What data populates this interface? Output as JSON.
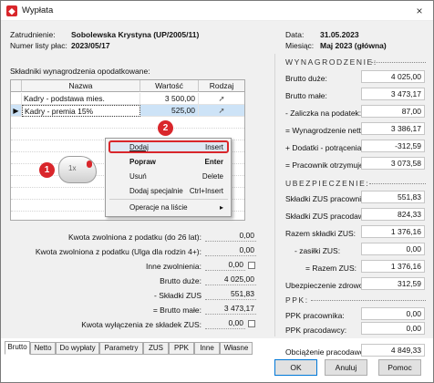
{
  "window": {
    "title": "Wypłata",
    "close_symbol": "×"
  },
  "header": {
    "employee_label": "Zatrudnienie:",
    "employee_value": "Sobolewska Krystyna (UP/2005/11)",
    "list_label": "Numer listy płac:",
    "list_value": "2023/05/17",
    "date_label": "Data:",
    "date_value": "31.05.2023",
    "month_label": "Miesiąc:",
    "month_value": "Maj 2023 (główna)"
  },
  "components": {
    "label": "Składniki wynagrodzenia opodatkowane:",
    "columns": [
      "Nazwa",
      "Wartość",
      "Rodzaj"
    ],
    "rows": [
      {
        "name": "Kadry - podstawa mies.",
        "value": "3 500,00"
      },
      {
        "name": "Kadry - premia 15%",
        "value": "525,00"
      }
    ]
  },
  "context_menu": {
    "items": [
      {
        "label": "Dodaj",
        "shortcut": "Insert"
      },
      {
        "label": "Popraw",
        "shortcut": "Enter"
      },
      {
        "label": "Usuń",
        "shortcut": "Delete"
      },
      {
        "label": "Dodaj specjalnie",
        "shortcut": "Ctrl+Insert"
      },
      {
        "label": "Operacje na liście",
        "shortcut": "▸"
      }
    ]
  },
  "tutorial": {
    "badge1": "1",
    "badge2": "2",
    "mouse_label": "1x"
  },
  "left_summary": [
    {
      "label": "Kwota zwolniona z podatku (do 26 lat):",
      "value": "0,00"
    },
    {
      "label": "Kwota zwolniona z podatku (Ulga dla rodzin 4+):",
      "value": "0,00"
    },
    {
      "label": "Inne zwolnienia:",
      "value": "0,00"
    },
    {
      "label": "Brutto duże:",
      "value": "4 025,00"
    },
    {
      "label": "-  Składki ZUS",
      "value": "551,83"
    },
    {
      "label": "= Brutto małe:",
      "value": "3 473,17"
    },
    {
      "label": "Kwota wyłączenia ze składek ZUS:",
      "value": "0,00"
    }
  ],
  "wynagrodzenie": {
    "title": "WYNAGRODZENIE:",
    "rows": [
      {
        "label": "Brutto duże:",
        "value": "4 025,00"
      },
      {
        "label": "Brutto małe:",
        "value": "3 473,17"
      },
      {
        "label": "- Zaliczka na podatek:",
        "value": "87,00"
      },
      {
        "label": "= Wynagrodzenie netto:",
        "value": "3 386,17"
      },
      {
        "label": "+ Dodatki - potrącenia:",
        "value": "-312,59"
      },
      {
        "label": "= Pracownik otrzymuje:",
        "value": "3 073,58"
      }
    ]
  },
  "ubezpieczenie": {
    "title": "UBEZPIECZENIE:",
    "rows": [
      {
        "label": "Składki ZUS pracownika:",
        "value": "551,83"
      },
      {
        "label": "Składki ZUS pracodawcy:",
        "value": "824,33"
      },
      {
        "label": "Razem składki ZUS:",
        "value": "1 376,16"
      },
      {
        "label": "- zasiłki ZUS:",
        "value": "0,00"
      },
      {
        "label": "= Razem ZUS:",
        "value": "1 376,16"
      },
      {
        "label": "Ubezpieczenie zdrowotne:",
        "value": "312,59"
      }
    ]
  },
  "ppk": {
    "title": "PPK:",
    "rows": [
      {
        "label": "PPK pracownika:",
        "value": "0,00"
      },
      {
        "label": "PPK pracodawcy:",
        "value": "0,00"
      }
    ]
  },
  "obciazenie": {
    "label": "Obciążenie pracodawcy:",
    "value": "4 849,33"
  },
  "tabs": [
    "Brutto",
    "Netto",
    "Do wypłaty",
    "Parametry",
    "ZUS",
    "PPK",
    "Inne",
    "Własne"
  ],
  "buttons": {
    "ok": "OK",
    "cancel": "Anuluj",
    "help": "Pomoc"
  }
}
